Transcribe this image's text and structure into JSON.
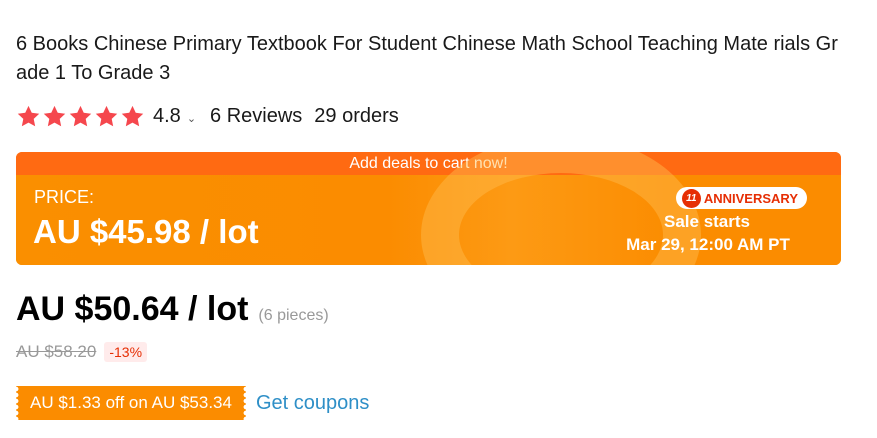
{
  "product": {
    "title": "6 Books Chinese Primary Textbook For Student Chinese Math School Teaching Mate rials Grade 1 To Grade 3"
  },
  "rating": {
    "stars": 5,
    "star_color": "#f5474d",
    "value": "4.8",
    "chevron_icon": "chevron-down-icon",
    "reviews": "6 Reviews",
    "orders": "29 orders"
  },
  "deal": {
    "banner_text": "Add deals to cart now!",
    "price_label": "PRICE:",
    "price": "AU $45.98 / lot",
    "badge_logo": "11",
    "badge_text": "ANNIVERSARY",
    "sale_starts": "Sale starts",
    "sale_date": "Mar 29, 12:00 AM PT",
    "colors": {
      "banner_top": "#ff6a12",
      "banner_body": "#fb8c00",
      "badge_text": "#e62e04"
    }
  },
  "pricing": {
    "main_price": "AU $50.64 / lot",
    "pieces": "(6 pieces)",
    "old_price": "AU $58.20",
    "discount": "-13%"
  },
  "coupon": {
    "tag": "AU $1.33 off on AU $53.34",
    "link": "Get coupons",
    "link_color": "#2e8fc7"
  }
}
